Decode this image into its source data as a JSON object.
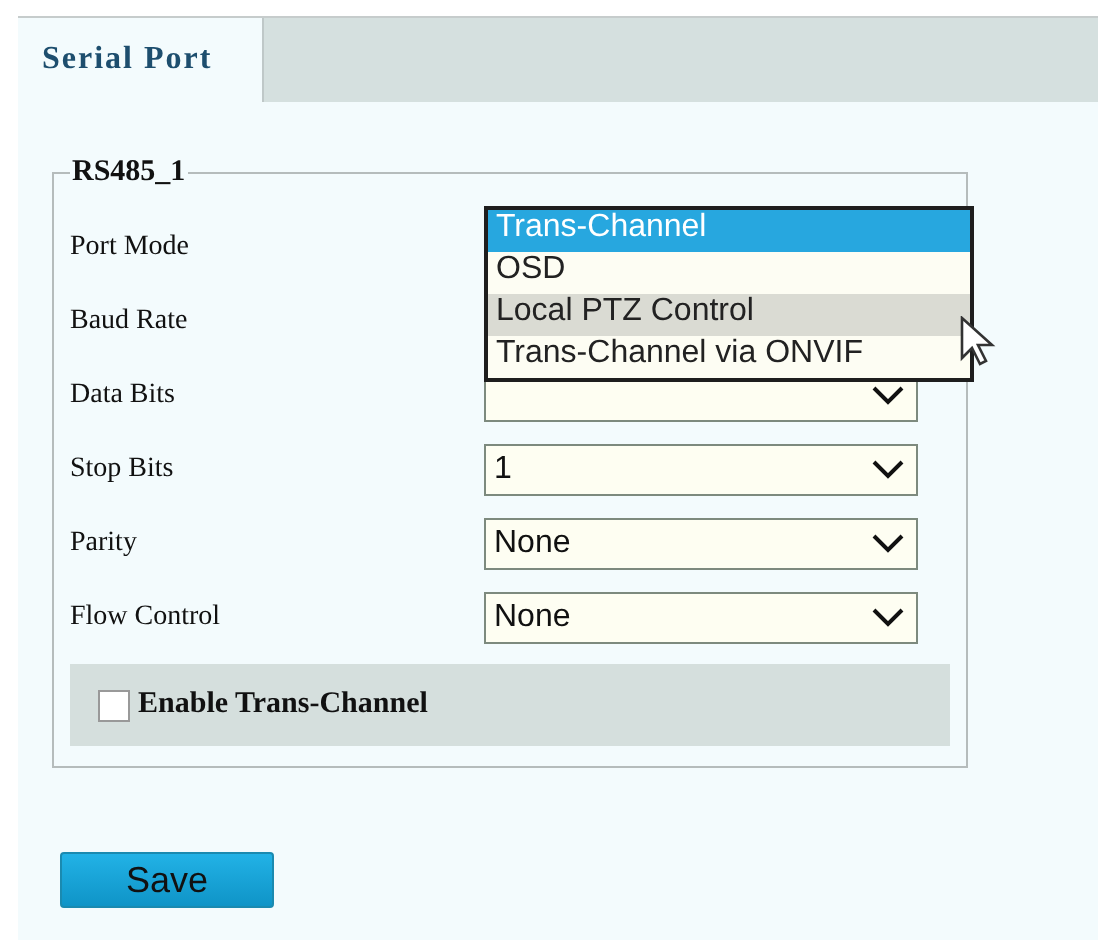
{
  "tabs": [
    {
      "label": "Serial Port",
      "selected": true
    }
  ],
  "port_group": {
    "title": "RS485_1",
    "fields": [
      {
        "label": "Port Mode",
        "dropdown": {
          "options": [
            {
              "label": "Trans-Channel",
              "selected": true,
              "hovered": false
            },
            {
              "label": "OSD",
              "selected": false,
              "hovered": false
            },
            {
              "label": "Local PTZ Control",
              "selected": false,
              "hovered": true
            },
            {
              "label": "Trans-Channel via ONVIF",
              "selected": false,
              "hovered": false
            }
          ]
        }
      },
      {
        "label": "Baud Rate"
      },
      {
        "label": "Data Bits"
      },
      {
        "label": "Stop Bits",
        "value": "1"
      },
      {
        "label": "Parity",
        "value": "None"
      },
      {
        "label": "Flow Control",
        "value": "None"
      }
    ],
    "enable_trans_channel": {
      "label": "Enable Trans-Channel",
      "checked": false
    }
  },
  "buttons": [
    {
      "label": "Save"
    }
  ]
}
